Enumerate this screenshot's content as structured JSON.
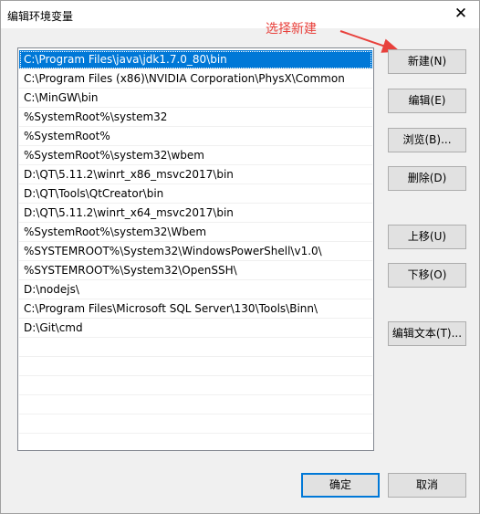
{
  "window": {
    "title": "编辑环境变量",
    "close_glyph": "✕"
  },
  "annotation": {
    "text": "选择新建",
    "color": "#e8413c"
  },
  "path_list": {
    "items": [
      "C:\\Program Files\\java\\jdk1.7.0_80\\bin",
      "C:\\Program Files (x86)\\NVIDIA Corporation\\PhysX\\Common",
      "C:\\MinGW\\bin",
      "%SystemRoot%\\system32",
      "%SystemRoot%",
      "%SystemRoot%\\system32\\wbem",
      "D:\\QT\\5.11.2\\winrt_x86_msvc2017\\bin",
      "D:\\QT\\Tools\\QtCreator\\bin",
      "D:\\QT\\5.11.2\\winrt_x64_msvc2017\\bin",
      "%SystemRoot%\\system32\\Wbem",
      "%SYSTEMROOT%\\System32\\WindowsPowerShell\\v1.0\\",
      "%SYSTEMROOT%\\System32\\OpenSSH\\",
      "D:\\nodejs\\",
      "C:\\Program Files\\Microsoft SQL Server\\130\\Tools\\Binn\\",
      "D:\\Git\\cmd"
    ],
    "selected_index": 0
  },
  "buttons": {
    "new": "新建(N)",
    "edit": "编辑(E)",
    "browse": "浏览(B)...",
    "delete": "删除(D)",
    "move_up": "上移(U)",
    "move_down": "下移(O)",
    "edit_text": "编辑文本(T)...",
    "ok": "确定",
    "cancel": "取消"
  },
  "colors": {
    "selection": "#0078d7",
    "dialog_bg": "#f0f0f0",
    "button_bg": "#e1e1e1"
  }
}
